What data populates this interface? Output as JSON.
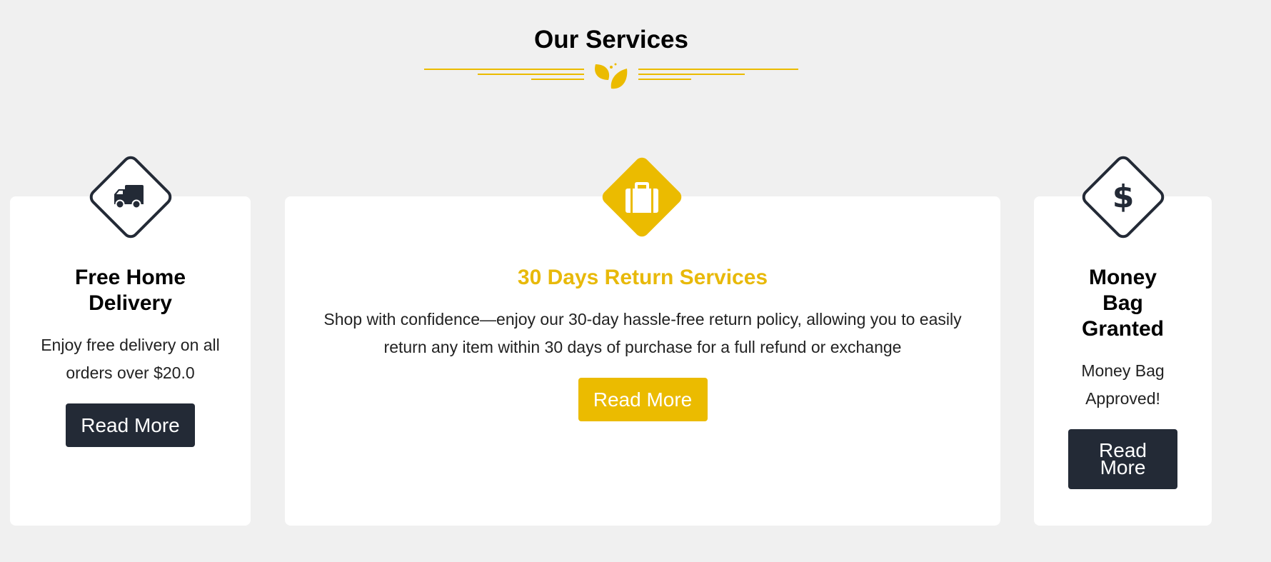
{
  "section": {
    "title": "Our Services",
    "ornament_icon": "leaves-icon"
  },
  "colors": {
    "accent": "#ebbb00",
    "dark": "#232a36",
    "background": "#f0f0f0",
    "card": "#ffffff"
  },
  "services": [
    {
      "icon": "truck-icon",
      "title": "Free Home Delivery",
      "text": "Enjoy free delivery on all orders over $20.0",
      "button": "Read More"
    },
    {
      "icon": "briefcase-icon",
      "title": "30 Days Return Services",
      "text": "Shop with confidence—enjoy our 30-day hassle-free return policy, allowing you to easily return any item within 30 days of purchase for a full refund or exchange",
      "button": "Read More"
    },
    {
      "icon": "dollar-icon",
      "title": "Money Bag Granted",
      "text": "Money Bag Approved!",
      "button": "Read More"
    }
  ]
}
